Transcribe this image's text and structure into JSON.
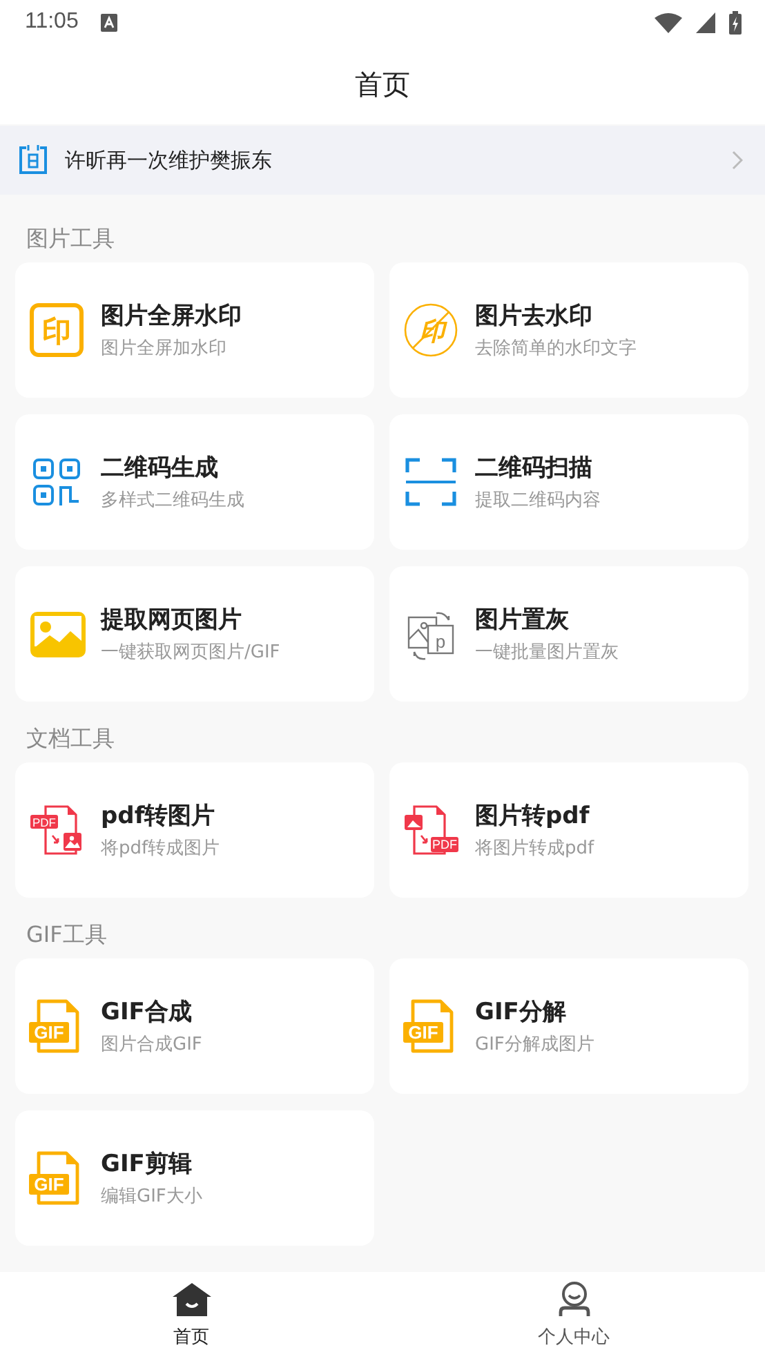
{
  "status_bar": {
    "time": "11:05"
  },
  "header": {
    "title": "首页"
  },
  "notice": {
    "text": "许昕再一次维护樊振东"
  },
  "sections": [
    {
      "title": "图片工具",
      "tools": [
        {
          "title": "图片全屏水印",
          "subtitle": "图片全屏加水印",
          "icon_text": "印"
        },
        {
          "title": "图片去水印",
          "subtitle": "去除简单的水印文字",
          "icon_text": "印"
        },
        {
          "title": "二维码生成",
          "subtitle": "多样式二维码生成"
        },
        {
          "title": "二维码扫描",
          "subtitle": "提取二维码内容"
        },
        {
          "title": "提取网页图片",
          "subtitle": "一键获取网页图片/GIF"
        },
        {
          "title": "图片置灰",
          "subtitle": "一键批量图片置灰",
          "icon_text": "p"
        }
      ]
    },
    {
      "title": "文档工具",
      "tools": [
        {
          "title": "pdf转图片",
          "subtitle": "将pdf转成图片",
          "icon_text": "PDF"
        },
        {
          "title": "图片转pdf",
          "subtitle": "将图片转成pdf",
          "icon_text": "PDF"
        }
      ]
    },
    {
      "title": "GIF工具",
      "tools": [
        {
          "title": "GIF合成",
          "subtitle": "图片合成GIF",
          "icon_text": "GIF"
        },
        {
          "title": "GIF分解",
          "subtitle": "GIF分解成图片",
          "icon_text": "GIF"
        },
        {
          "title": "GIF剪辑",
          "subtitle": "编辑GIF大小",
          "icon_text": "GIF"
        }
      ]
    }
  ],
  "nav": [
    {
      "label": "首页",
      "selected": true
    },
    {
      "label": "个人中心",
      "selected": false
    }
  ]
}
